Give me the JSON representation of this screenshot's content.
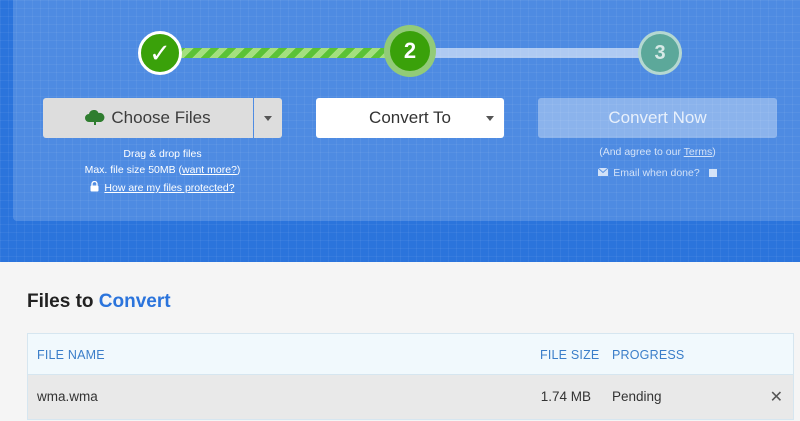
{
  "stepper": {
    "step1_symbol": "✓",
    "step2_label": "2",
    "step3_label": "3"
  },
  "choose_files": {
    "label": "Choose Files",
    "icon": "cloud-upload-icon",
    "hint_drag": "Drag & drop files",
    "hint_size_prefix": "Max. file size 50MB (",
    "hint_size_link": "want more?",
    "hint_size_suffix": ")",
    "protect_link": "How are my files protected?"
  },
  "convert_to": {
    "label": "Convert To"
  },
  "convert_now": {
    "label": "Convert Now",
    "agree_prefix": "(And agree to our ",
    "agree_link": "Terms",
    "agree_suffix": ")",
    "email_label": "Email when done?"
  },
  "files": {
    "title_prefix": "Files to ",
    "title_accent": "Convert",
    "headers": {
      "name": "FILE NAME",
      "size": "FILE SIZE",
      "progress": "PROGRESS"
    },
    "rows": [
      {
        "name": "wma.wma",
        "size": "1.74 MB",
        "progress": "Pending"
      }
    ]
  },
  "colors": {
    "brand_blue": "#2b74dc",
    "step_green": "#3aa10a"
  }
}
